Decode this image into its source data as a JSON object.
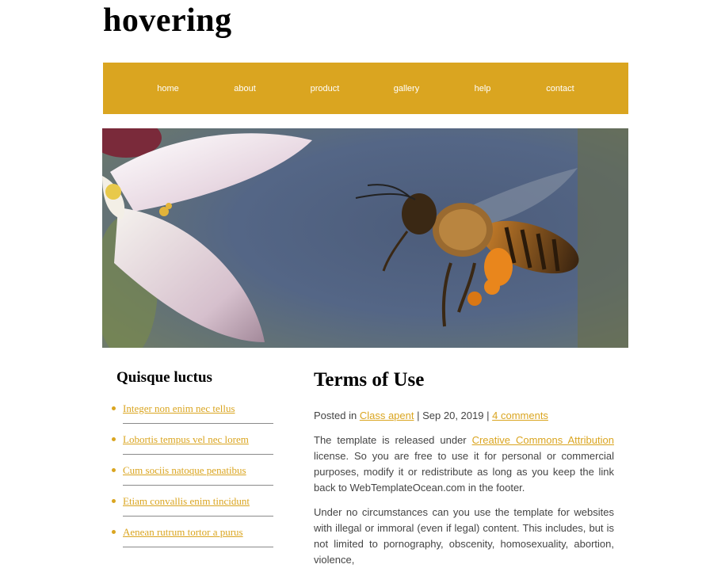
{
  "site": {
    "title": "hovering"
  },
  "nav": {
    "items": [
      {
        "label": "home"
      },
      {
        "label": "about"
      },
      {
        "label": "product"
      },
      {
        "label": "gallery"
      },
      {
        "label": "help"
      },
      {
        "label": "contact"
      }
    ]
  },
  "hero": {
    "icon": "bee-photo"
  },
  "sidebar": {
    "title": "Quisque luctus",
    "links": [
      {
        "label": "Integer non enim nec tellus"
      },
      {
        "label": "Lobortis tempus vel nec lorem"
      },
      {
        "label": "Cum sociis natoque penatibus"
      },
      {
        "label": "Etiam convallis enim tincidunt"
      },
      {
        "label": "Aenean rutrum tortor a purus"
      }
    ]
  },
  "article": {
    "title": "Terms of Use",
    "meta": {
      "posted_in": "Posted in",
      "category": "Class apent",
      "sep1": "|",
      "date": "Sep 20, 2019",
      "sep2": "|",
      "comments": "4 comments"
    },
    "p1": {
      "before": "The template is released under",
      "link": "Creative Commons Attribution",
      "after": "license. So you are free to use it for personal or commercial purposes, modify it or redistribute as long as you keep the link back to WebTemplateOcean.com in the footer."
    },
    "p2": "Under no circumstances can you use the template for websites with illegal or immoral (even if legal) content. This includes, but is not limited to pornography, obscenity, homosexuality, abortion, violence,"
  },
  "colors": {
    "accent": "#daa520",
    "text": "#444444"
  }
}
